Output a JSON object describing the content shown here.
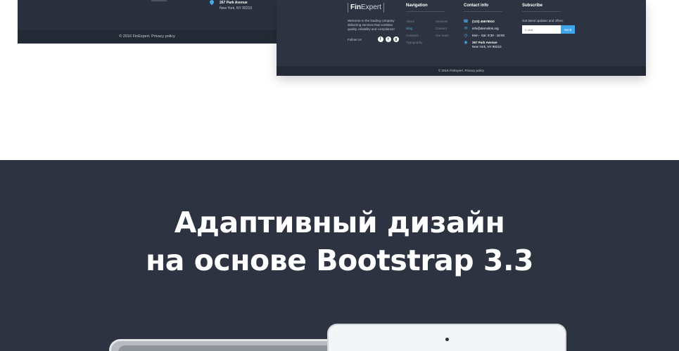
{
  "left_preview": {
    "address_street": "267 Park Avenue",
    "address_city": "New York, NY 90210",
    "copyright": "© 2016 FinExpert. Privacy policy"
  },
  "right_preview": {
    "logo_bold": "Fin",
    "logo_light": "Expert",
    "about": "Welcome to the leading company delivering services that combine quality, reliability and compliance!",
    "follow_label": "Follow Us",
    "social": [
      {
        "icon": "facebook-icon",
        "glyph": "f"
      },
      {
        "icon": "twitter-icon",
        "glyph": "t"
      },
      {
        "icon": "google-plus-icon",
        "glyph": "g"
      }
    ],
    "navigation": {
      "title": "Navigation",
      "col1": [
        "About",
        "Blog",
        "Contacts",
        "Typography"
      ],
      "col2": [
        "Services",
        "Careers",
        "Our team"
      ],
      "active": "Blog"
    },
    "contact": {
      "title": "Contact info",
      "phone": "(123) 45678910",
      "email": "info@demolink.org",
      "hours": "Mon - Sat: 9:30 - 18:00",
      "address_street": "267 Park Avenue",
      "address_city": "New York, NY 90210"
    },
    "subscribe": {
      "title": "Subscribe",
      "text": "Get latest updates and offers.",
      "placeholder": "E-Mail",
      "button": "Send"
    },
    "copyright": "© 2016 FinExpert. Privacy policy"
  },
  "section": {
    "title_line1": "Адаптивный дизайн",
    "title_line2": "на основе Bootstrap 3.3"
  },
  "colors": {
    "dark_bg": "#2d3340",
    "accent": "#3ea6e8"
  }
}
